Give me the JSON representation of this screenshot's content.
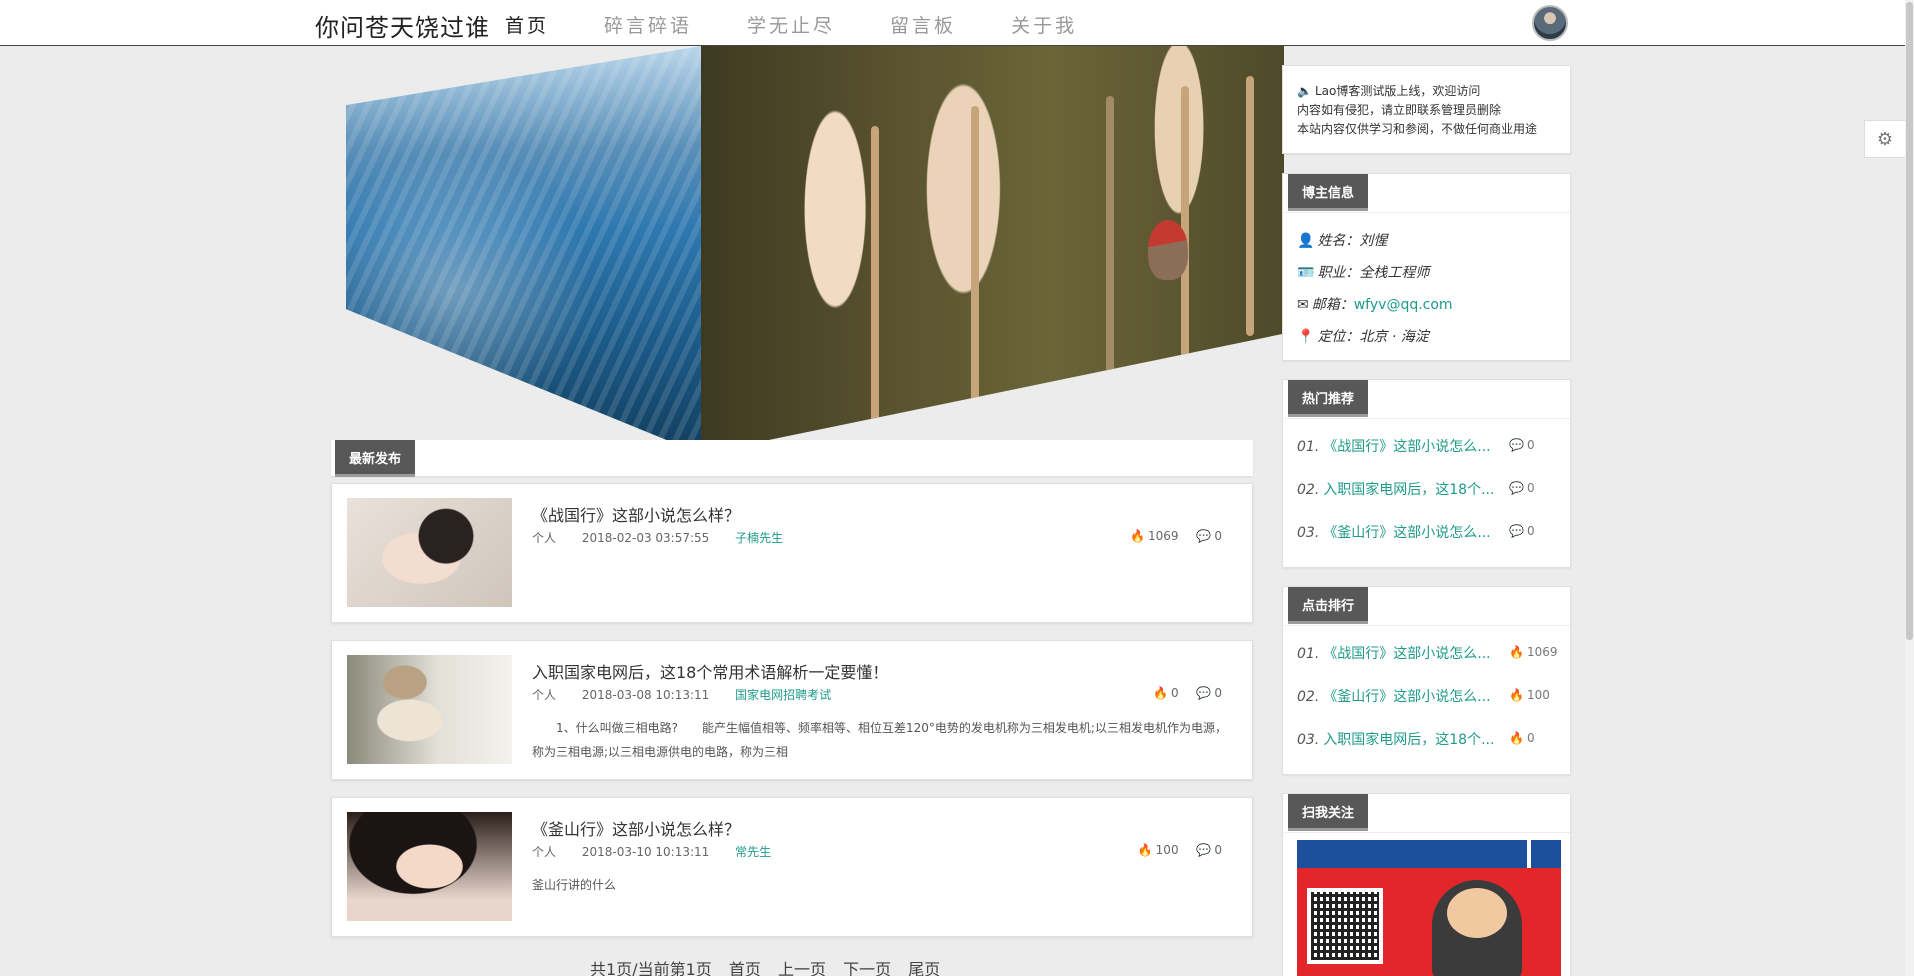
{
  "header": {
    "site_title": "你问苍天饶过谁",
    "nav": [
      {
        "label": "首页",
        "active": true
      },
      {
        "label": "碎言碎语",
        "active": false
      },
      {
        "label": "学无止尽",
        "active": false
      },
      {
        "label": "留言板",
        "active": false
      },
      {
        "label": "关于我",
        "active": false
      }
    ]
  },
  "carousel": {
    "dots": 3,
    "active_dot": 3
  },
  "latest": {
    "label": "最新发布",
    "articles": [
      {
        "title": "《战国行》这部小说怎么样？",
        "category": "个人",
        "date": "2018-02-03 03:57:55",
        "tag": "子楠先生",
        "views": "1069",
        "comments": "0",
        "excerpt": ""
      },
      {
        "title": "入职国家电网后，这18个常用术语解析一定要懂！",
        "category": "个人",
        "date": "2018-03-08 10:13:11",
        "tag": "国家电网招聘考试",
        "views": "0",
        "comments": "0",
        "excerpt": "　　1、什么叫做三相电路?　　能产生幅值相等、频率相等、相位互差120°电势的发电机称为三相发电机;以三相发电机作为电源，称为三相电源;以三相电源供电的电路，称为三相"
      },
      {
        "title": "《釜山行》这部小说怎么样？",
        "category": "个人",
        "date": "2018-03-10 10:13:11",
        "tag": "常先生",
        "views": "100",
        "comments": "0",
        "excerpt": "釜山行讲的什么"
      }
    ]
  },
  "pager": {
    "summary": "共1页/当前第1页",
    "first": "首页",
    "prev": "上一页",
    "next": "下一页",
    "last": "尾页"
  },
  "sidebar": {
    "notice": [
      "Lao博客测试版上线，欢迎访问",
      "内容如有侵犯，请立即联系管理员删除",
      "本站内容仅供学习和参阅，不做任何商业用途"
    ],
    "owner": {
      "label": "博主信息",
      "name": "姓名：刘惺",
      "job": "职业：全栈工程师",
      "email_label": "邮箱：",
      "email": "wfyv@qq.com",
      "location": "定位：北京 · 海淀"
    },
    "hot": {
      "label": "热门推荐",
      "items": [
        {
          "num": "01.",
          "title": "《战国行》这部小说怎么...",
          "count": "0"
        },
        {
          "num": "02.",
          "title": "入职国家电网后，这18个...",
          "count": "0"
        },
        {
          "num": "03.",
          "title": "《釜山行》这部小说怎么...",
          "count": "0"
        }
      ]
    },
    "clicks": {
      "label": "点击排行",
      "items": [
        {
          "num": "01.",
          "title": "《战国行》这部小说怎么...",
          "count": "1069"
        },
        {
          "num": "02.",
          "title": "《釜山行》这部小说怎么...",
          "count": "100"
        },
        {
          "num": "03.",
          "title": "入职国家电网后，这18个...",
          "count": "0"
        }
      ]
    },
    "follow": {
      "label": "扫我关注"
    }
  },
  "colors": {
    "accent_green": "#1f9b8a",
    "label_bg": "#585858",
    "active_dot": "#2e8fd4"
  }
}
